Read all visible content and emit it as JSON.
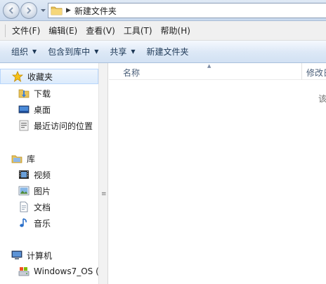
{
  "address": {
    "crumbs": [
      "新建文件夹"
    ]
  },
  "menubar": {
    "items": [
      "文件(F)",
      "编辑(E)",
      "查看(V)",
      "工具(T)",
      "帮助(H)"
    ]
  },
  "commandbar": {
    "items": [
      "组织",
      "包含到库中",
      "共享",
      "新建文件夹"
    ]
  },
  "navpane": {
    "favorites": {
      "label": "收藏夹",
      "items": [
        "下载",
        "桌面",
        "最近访问的位置"
      ]
    },
    "libraries": {
      "label": "库",
      "items": [
        "视频",
        "图片",
        "文档",
        "音乐"
      ]
    },
    "computer": {
      "label": "计算机",
      "items": [
        "Windows7_OS ("
      ]
    }
  },
  "content": {
    "columns": [
      "名称",
      "修改日"
    ],
    "empty_text": "该"
  },
  "colors": {
    "accent": "#dcebfc",
    "toolbar_text": "#1e3957"
  },
  "icons": [
    "back-arrow-icon",
    "forward-arrow-icon",
    "folder-icon",
    "star-icon",
    "download-folder-icon",
    "desktop-icon",
    "recent-places-icon",
    "library-icon",
    "video-icon",
    "picture-icon",
    "document-icon",
    "music-icon",
    "computer-icon",
    "drive-icon"
  ]
}
